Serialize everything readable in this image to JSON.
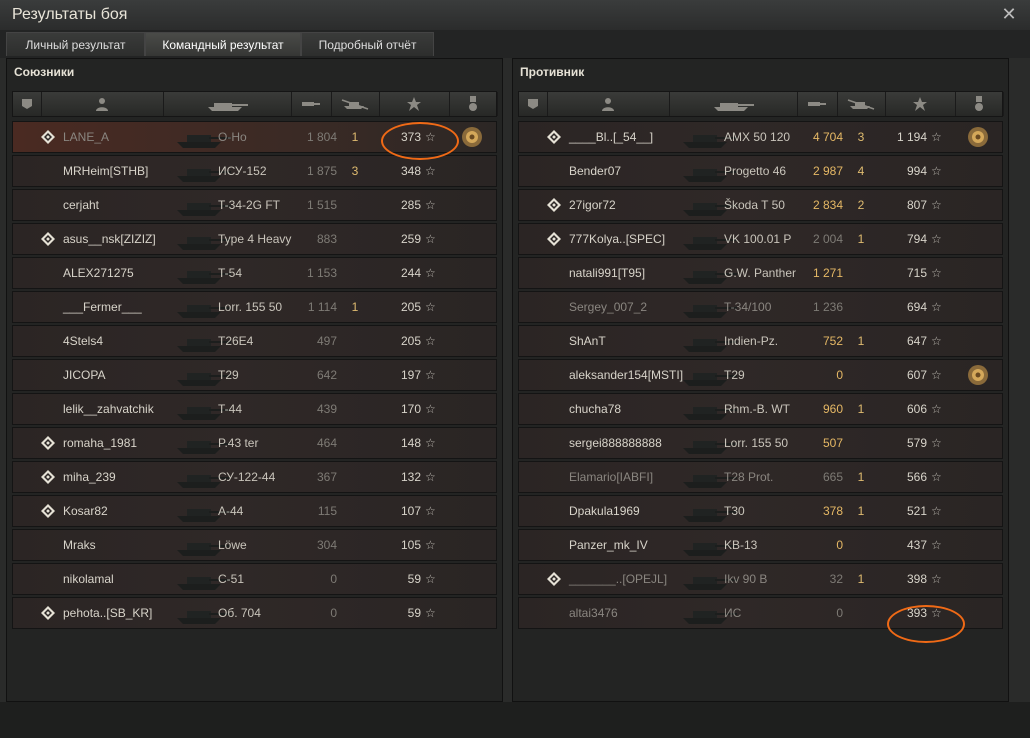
{
  "window": {
    "title": "Результаты боя",
    "close_icon": "close-icon"
  },
  "tabs": [
    {
      "label": "Личный результат",
      "active": false
    },
    {
      "label": "Командный результат",
      "active": true
    },
    {
      "label": "Подробный отчёт",
      "active": false
    }
  ],
  "colors": {
    "highlight_oval": "#f06a16",
    "damage_gold": "#e5b865",
    "kill_gold": "#dfbb70"
  },
  "columns": [
    "platoon-icon",
    "player-icon",
    "tank-icon",
    "damage-icon",
    "kills-icon",
    "xp-star-icon",
    "medal-icon"
  ],
  "allies": {
    "title": "Союзники",
    "rows": [
      {
        "name": "LANE_A",
        "tank": "O-Ho",
        "damage": "1 804",
        "kills": "1",
        "xp": "373",
        "platoon": true,
        "medal": true,
        "highlight": true,
        "dead": true,
        "gold": false
      },
      {
        "name": "MRHeim[STHB]",
        "tank": "ИСУ-152",
        "damage": "1 875",
        "kills": "3",
        "xp": "348",
        "platoon": false,
        "medal": false,
        "highlight": false,
        "dead": false,
        "gold": false
      },
      {
        "name": "cerjaht",
        "tank": "T-34-2G FT",
        "damage": "1 515",
        "kills": "",
        "xp": "285",
        "platoon": false,
        "medal": false,
        "highlight": false,
        "dead": false,
        "gold": false
      },
      {
        "name": "asus__nsk[ZIZIZ]",
        "tank": "Type 4 Heavy",
        "damage": "883",
        "kills": "",
        "xp": "259",
        "platoon": true,
        "medal": false,
        "highlight": false,
        "dead": false,
        "gold": false
      },
      {
        "name": "ALEX271275",
        "tank": "T-54",
        "damage": "1 153",
        "kills": "",
        "xp": "244",
        "platoon": false,
        "medal": false,
        "highlight": false,
        "dead": false,
        "gold": false
      },
      {
        "name": "___Fermer___",
        "tank": "Lorr. 155 50",
        "damage": "1 114",
        "kills": "1",
        "xp": "205",
        "platoon": false,
        "medal": false,
        "highlight": false,
        "dead": false,
        "gold": false
      },
      {
        "name": "4Stels4",
        "tank": "T26E4",
        "damage": "497",
        "kills": "",
        "xp": "205",
        "platoon": false,
        "medal": false,
        "highlight": false,
        "dead": false,
        "gold": false
      },
      {
        "name": "JICOPA",
        "tank": "T29",
        "damage": "642",
        "kills": "",
        "xp": "197",
        "platoon": false,
        "medal": false,
        "highlight": false,
        "dead": false,
        "gold": false
      },
      {
        "name": "lelik__zahvatchik",
        "tank": "T-44",
        "damage": "439",
        "kills": "",
        "xp": "170",
        "platoon": false,
        "medal": false,
        "highlight": false,
        "dead": false,
        "gold": false
      },
      {
        "name": "romaha_1981",
        "tank": "P.43 ter",
        "damage": "464",
        "kills": "",
        "xp": "148",
        "platoon": true,
        "medal": false,
        "highlight": false,
        "dead": false,
        "gold": false
      },
      {
        "name": "miha_239",
        "tank": "СУ-122-44",
        "damage": "367",
        "kills": "",
        "xp": "132",
        "platoon": true,
        "medal": false,
        "highlight": false,
        "dead": false,
        "gold": false
      },
      {
        "name": "Kosar82",
        "tank": "A-44",
        "damage": "115",
        "kills": "",
        "xp": "107",
        "platoon": true,
        "medal": false,
        "highlight": false,
        "dead": false,
        "gold": false
      },
      {
        "name": "Mraks",
        "tank": "Löwe",
        "damage": "304",
        "kills": "",
        "xp": "105",
        "platoon": false,
        "medal": false,
        "highlight": false,
        "dead": false,
        "gold": false
      },
      {
        "name": "nikolamal",
        "tank": "C-51",
        "damage": "0",
        "kills": "",
        "xp": "59",
        "platoon": false,
        "medal": false,
        "highlight": false,
        "dead": false,
        "gold": false
      },
      {
        "name": "pehota..[SB_KR]",
        "tank": "Об. 704",
        "damage": "0",
        "kills": "",
        "xp": "59",
        "platoon": true,
        "medal": false,
        "highlight": false,
        "dead": false,
        "gold": false
      }
    ]
  },
  "enemies": {
    "title": "Противник",
    "rows": [
      {
        "name": "____Bl..[_54__]",
        "tank": "AMX 50 120",
        "damage": "4 704",
        "kills": "3",
        "xp": "1 194",
        "platoon": true,
        "medal": true,
        "highlight": false,
        "dead": false,
        "gold": true
      },
      {
        "name": "Bender07",
        "tank": "Progetto 46",
        "damage": "2 987",
        "kills": "4",
        "xp": "994",
        "platoon": false,
        "medal": false,
        "highlight": false,
        "dead": false,
        "gold": true
      },
      {
        "name": "27igor72",
        "tank": "Škoda T 50",
        "damage": "2 834",
        "kills": "2",
        "xp": "807",
        "platoon": true,
        "medal": false,
        "highlight": false,
        "dead": false,
        "gold": true
      },
      {
        "name": "777Kolya..[SPEC]",
        "tank": "VK 100.01 P",
        "damage": "2 004",
        "kills": "1",
        "xp": "794",
        "platoon": true,
        "medal": false,
        "highlight": false,
        "dead": false,
        "gold": false
      },
      {
        "name": "natali991[T95]",
        "tank": "G.W. Panther",
        "damage": "1 271",
        "kills": "",
        "xp": "715",
        "platoon": false,
        "medal": false,
        "highlight": false,
        "dead": false,
        "gold": true
      },
      {
        "name": "Sergey_007_2",
        "tank": "T-34/100",
        "damage": "1 236",
        "kills": "",
        "xp": "694",
        "platoon": false,
        "medal": false,
        "highlight": false,
        "dead": true,
        "gold": false
      },
      {
        "name": "ShAnT",
        "tank": "Indien-Pz.",
        "damage": "752",
        "kills": "1",
        "xp": "647",
        "platoon": false,
        "medal": false,
        "highlight": false,
        "dead": false,
        "gold": true
      },
      {
        "name": "aleksander154[MSTI]",
        "tank": "T29",
        "damage": "0",
        "kills": "",
        "xp": "607",
        "platoon": false,
        "medal": true,
        "highlight": false,
        "dead": false,
        "gold": true
      },
      {
        "name": "chucha78",
        "tank": "Rhm.-B. WT",
        "damage": "960",
        "kills": "1",
        "xp": "606",
        "platoon": false,
        "medal": false,
        "highlight": false,
        "dead": false,
        "gold": true
      },
      {
        "name": "sergei888888888",
        "tank": "Lorr. 155 50",
        "damage": "507",
        "kills": "",
        "xp": "579",
        "platoon": false,
        "medal": false,
        "highlight": false,
        "dead": false,
        "gold": true
      },
      {
        "name": "Elamario[IABFI]",
        "tank": "T28 Prot.",
        "damage": "665",
        "kills": "1",
        "xp": "566",
        "platoon": false,
        "medal": false,
        "highlight": false,
        "dead": true,
        "gold": false
      },
      {
        "name": "Dpakula1969",
        "tank": "T30",
        "damage": "378",
        "kills": "1",
        "xp": "521",
        "platoon": false,
        "medal": false,
        "highlight": false,
        "dead": false,
        "gold": true
      },
      {
        "name": "Panzer_mk_IV",
        "tank": "KB-13",
        "damage": "0",
        "kills": "",
        "xp": "437",
        "platoon": false,
        "medal": false,
        "highlight": false,
        "dead": false,
        "gold": true
      },
      {
        "name": "_______..[OPEJL]",
        "tank": "Ikv 90 B",
        "damage": "32",
        "kills": "1",
        "xp": "398",
        "platoon": true,
        "medal": false,
        "highlight": false,
        "dead": true,
        "gold": false
      },
      {
        "name": "altai3476",
        "tank": "ИС",
        "damage": "0",
        "kills": "",
        "xp": "393",
        "platoon": false,
        "medal": false,
        "highlight": false,
        "dead": true,
        "gold": false
      }
    ]
  }
}
